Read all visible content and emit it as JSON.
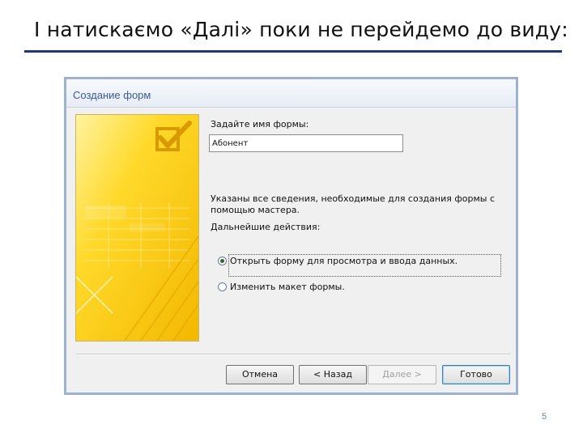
{
  "slide": {
    "title": "І натискаємо «Далі» поки не перейдемо до виду:",
    "page_number": "5"
  },
  "wizard": {
    "title": "Создание форм",
    "name_prompt": "Задайте имя формы:",
    "name_value": "Абонент",
    "info_line1": "Указаны все сведения, необходимые для создания формы с",
    "info_line2": "помощью мастера.",
    "next_actions_label": "Дальнейшие действия:",
    "options": [
      {
        "label": "Открыть форму для просмотра и ввода данных.",
        "checked": true
      },
      {
        "label": "Изменить макет формы.",
        "checked": false
      }
    ],
    "buttons": {
      "cancel": "Отмена",
      "back": "< Назад",
      "next": "Далее >",
      "finish": "Готово"
    }
  },
  "colors": {
    "title_rule": "#1f3a73",
    "wizard_border": "#9eb1cf",
    "wizard_title": "#3b5b95",
    "illustration_yellow": "#f5c400"
  }
}
